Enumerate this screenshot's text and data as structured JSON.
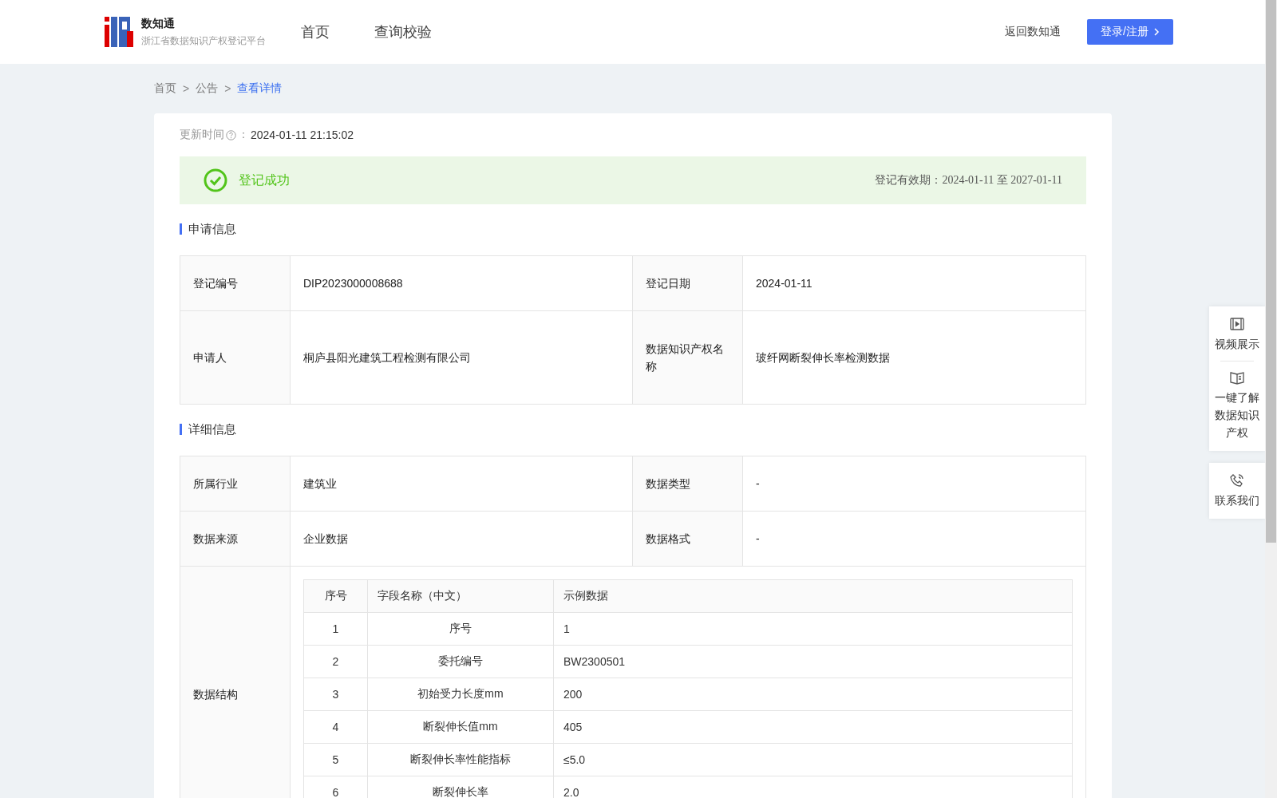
{
  "header": {
    "logo_title": "数知通",
    "logo_subtitle": "浙江省数据知识产权登记平台",
    "nav": [
      {
        "label": "首页",
        "selected": false
      },
      {
        "label": "查询校验",
        "selected": false
      }
    ],
    "back_link": "返回数知通",
    "login_button": "登录/注册"
  },
  "breadcrumb_separator": ">",
  "breadcrumb": [
    {
      "label": "首页",
      "selected": false
    },
    {
      "label": "公告",
      "selected": false
    },
    {
      "label": "查看详情",
      "selected": true
    }
  ],
  "update": {
    "label": "更新时间",
    "colon": "：",
    "value": "2024-01-11 21:15:02"
  },
  "status": {
    "text": "登记成功",
    "validity_label": "登记有效期：",
    "valid_from": "2024-01-11",
    "to": "至",
    "valid_to": "2027-01-11"
  },
  "sections": [
    {
      "title": "申请信息",
      "rows": [
        {
          "cells": [
            "登记编号",
            "DIP2023000008688",
            "登记日期",
            "2024-01-11"
          ]
        },
        {
          "cells": [
            "申请人",
            "桐庐县阳光建筑工程检测有限公司",
            "数据知识产权名称",
            "玻纤网断裂伸长率检测数据"
          ]
        }
      ]
    },
    {
      "title": "详细信息",
      "rows": [
        {
          "cells": [
            "所属行业",
            "建筑业",
            "数据类型",
            "-"
          ]
        },
        {
          "cells": [
            "数据来源",
            "企业数据",
            "数据格式",
            "-"
          ]
        }
      ],
      "structure": {
        "label": "数据结构",
        "columns": [
          "序号",
          "字段名称（中文）",
          "示例数据"
        ],
        "rows": [
          [
            "1",
            "序号",
            "1"
          ],
          [
            "2",
            "委托编号",
            "BW2300501"
          ],
          [
            "3",
            "初始受力长度mm",
            "200"
          ],
          [
            "4",
            "断裂伸长值mm",
            "405"
          ],
          [
            "5",
            "断裂伸长率性能指标",
            "≤5.0"
          ],
          [
            "6",
            "断裂伸长率",
            "2.0"
          ]
        ]
      }
    }
  ],
  "side_panel": [
    {
      "kind": "video",
      "label": "视频展示"
    },
    {
      "kind": "book",
      "label": "一键了解数据知识产权"
    },
    {
      "kind": "phone",
      "label": "联系我们"
    }
  ]
}
